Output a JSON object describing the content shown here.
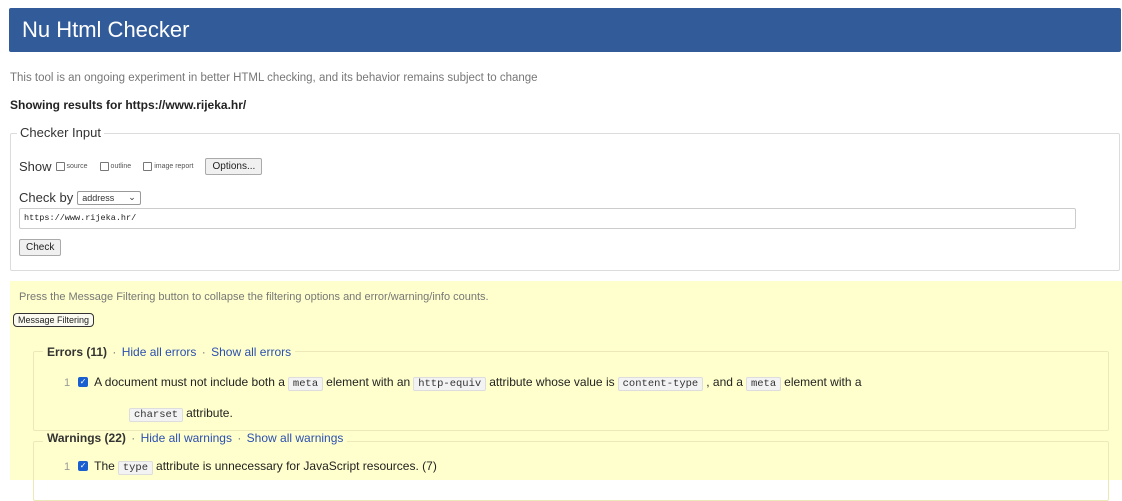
{
  "header": {
    "title": "Nu Html Checker"
  },
  "intro": "This tool is an ongoing experiment in better HTML checking, and its behavior remains subject to change",
  "showing": "Showing results for https://www.rijeka.hr/",
  "checker": {
    "legend": "Checker Input",
    "show_label": "Show",
    "options": [
      "source",
      "outline",
      "image report"
    ],
    "options_button": "Options...",
    "check_by_label": "Check by",
    "check_by_value": "address",
    "url": "https://www.rijeka.hr/",
    "check_button": "Check"
  },
  "filter": {
    "notice": "Press the Message Filtering button to collapse the filtering options and error/warning/info counts.",
    "button": "Message Filtering"
  },
  "errors": {
    "title": "Errors (11)",
    "hide": "Hide all errors",
    "show": "Show all errors",
    "item": {
      "number": "1",
      "t1": "A document must not include both a",
      "c1": "meta",
      "t2": "element with an",
      "c2": "http-equiv",
      "t3": "attribute whose value is",
      "c3": "content-type",
      "t4": ", and a",
      "c4": "meta",
      "t5": "element with a",
      "c5": "charset",
      "t6": "attribute."
    }
  },
  "warnings": {
    "title": "Warnings (22)",
    "hide": "Hide all warnings",
    "show": "Show all warnings",
    "item": {
      "number": "1",
      "t1": "The",
      "c1": "type",
      "t2": "attribute is unnecessary for JavaScript resources. (7)"
    }
  },
  "colors": {
    "header": "#325b9a",
    "filter_bg": "#ffffcd",
    "link": "#2b4fb0",
    "checkbox_checked": "#1a5fd0"
  }
}
